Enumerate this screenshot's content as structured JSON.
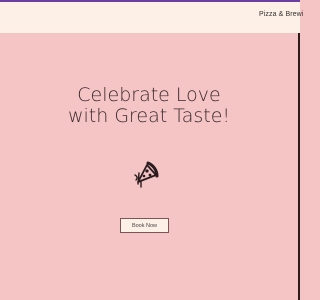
{
  "header": {
    "nav_text": "Pizza & Brewi"
  },
  "hero": {
    "headline_line1": "Celebrate Love",
    "headline_line2": "with Great Taste!",
    "icon": "pizza-slice-icon",
    "book_button_label": "Book Now"
  },
  "colors": {
    "background": "#f5c4c5",
    "header_background": "#fdf0e6",
    "header_top_border": "#6a3fa0",
    "text": "#3a2a2e",
    "button_background": "#fdf0e6",
    "button_border": "#7a5656"
  }
}
